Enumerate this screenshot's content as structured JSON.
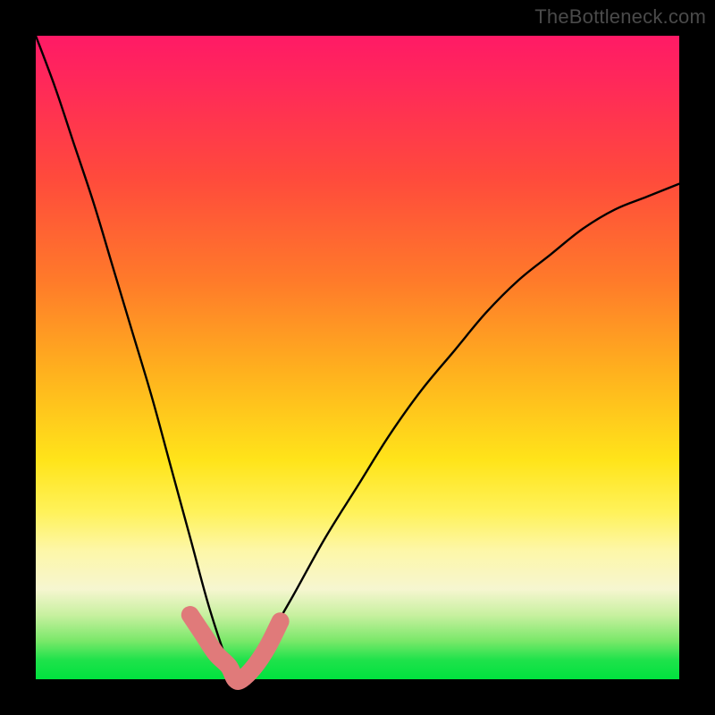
{
  "watermark": "TheBottleneck.com",
  "chart_data": {
    "type": "line",
    "title": "",
    "xlabel": "",
    "ylabel": "",
    "xlim": [
      0,
      100
    ],
    "ylim": [
      0,
      100
    ],
    "grid": false,
    "legend": false,
    "note": "Composite figure: a rainbow gradient background (red at top → green at bottom) with a black V-shaped bottleneck curve and a thick salmon marker band at the curve's minimum.",
    "series": [
      {
        "name": "bottleneck-curve",
        "color": "#000000",
        "x": [
          0,
          3,
          6,
          9,
          12,
          15,
          18,
          21,
          24,
          27,
          30,
          31,
          32,
          34,
          36,
          40,
          45,
          50,
          55,
          60,
          65,
          70,
          75,
          80,
          85,
          90,
          95,
          100
        ],
        "values": [
          100,
          92,
          83,
          74,
          64,
          54,
          44,
          33,
          22,
          11,
          2,
          0,
          0,
          2,
          6,
          13,
          22,
          30,
          38,
          45,
          51,
          57,
          62,
          66,
          70,
          73,
          75,
          77
        ]
      },
      {
        "name": "plateau-marker",
        "color": "#e07a7a",
        "x": [
          24,
          26,
          28,
          30,
          31,
          32,
          34,
          36,
          38
        ],
        "values": [
          10,
          7,
          4,
          2,
          0,
          0,
          2,
          5,
          9
        ]
      }
    ]
  }
}
